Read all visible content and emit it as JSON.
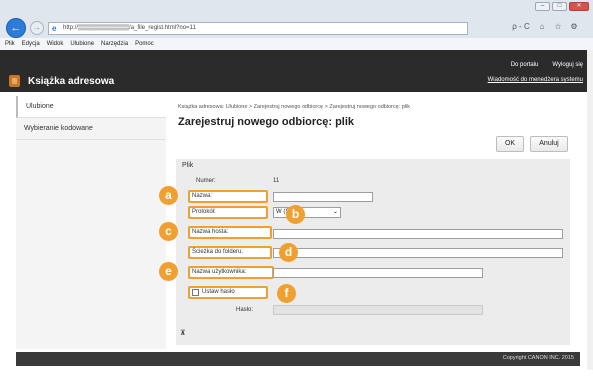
{
  "browser": {
    "url": "http://▒▒▒▒▒▒▒▒▒▒▒▒/a_file_regist.html?no=11",
    "search_symbol": "ρ - C",
    "tools": [
      "⌂",
      "☆",
      "⚙"
    ],
    "menu": [
      "Plik",
      "Edycja",
      "Widok",
      "Ulubione",
      "Narzędzia",
      "Pomoc"
    ]
  },
  "header": {
    "brand": "Książka adresowa",
    "links": [
      "Do portalu",
      "Wyloguj się"
    ],
    "message_link": "Wiadomość do menedżera systemu"
  },
  "sidebar": {
    "items": [
      {
        "label": "Ulubione"
      },
      {
        "label": "Wybieranie kodowane"
      }
    ]
  },
  "main": {
    "breadcrumb": "Książka adresowa: Ulubione > Zarejestruj nowego odbiorcę > Zarejestruj nowego odbiorcę: plik",
    "title": "Zarejestruj nowego odbiorcę: plik",
    "ok_label": "OK",
    "cancel_label": "Anuluj",
    "panel_title": "Plik",
    "number_label": "Numer:",
    "number_value": "11",
    "name_label": "Nazwa:",
    "protocol_label": "Protokół:",
    "protocol_value": "W  (SMB)",
    "host_label": "Nazwa hosta:",
    "folder_label": "Ścieżka do folderu:",
    "user_label": "Nazwa użytkownika:",
    "set_password_label": "Ustaw hasło",
    "password_label": "Hasło:",
    "collapse_symbol": "⊼"
  },
  "badges": [
    "a",
    "b",
    "c",
    "d",
    "e",
    "f"
  ],
  "footer": {
    "copyright": "Copyright CANON INC. 2015"
  },
  "colors": {
    "accent": "#f0a030",
    "header_bg": "#2b2b2b"
  }
}
